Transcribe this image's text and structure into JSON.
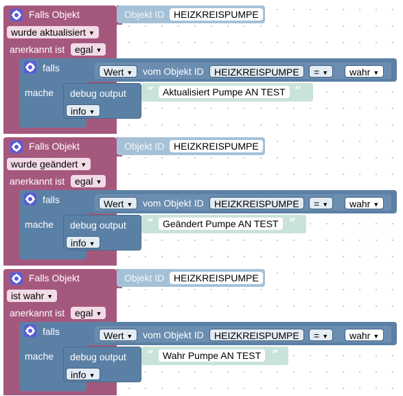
{
  "blocks": [
    {
      "trigger_label": "Falls Objekt",
      "object_id_label": "Objekt ID",
      "object_id_value": "HEIZKREISPUMPE",
      "event_type": "wurde aktualisiert",
      "ack_label": "anerkannt ist",
      "ack_value": "egal",
      "if_label": "falls",
      "do_label": "mache",
      "compare_left_value": "Wert",
      "compare_from_label": "vom Objekt ID",
      "compare_object_id": "HEIZKREISPUMPE",
      "operator": "=",
      "compare_right_value": "wahr",
      "debug_label": "debug output",
      "debug_text": "Aktualisiert Pumpe AN TEST",
      "debug_level": "info"
    },
    {
      "trigger_label": "Falls Objekt",
      "object_id_label": "Objekt ID",
      "object_id_value": "HEIZKREISPUMPE",
      "event_type": "wurde geändert",
      "ack_label": "anerkannt ist",
      "ack_value": "egal",
      "if_label": "falls",
      "do_label": "mache",
      "compare_left_value": "Wert",
      "compare_from_label": "vom Objekt ID",
      "compare_object_id": "HEIZKREISPUMPE",
      "operator": "=",
      "compare_right_value": "wahr",
      "debug_label": "debug output",
      "debug_text": "Geändert Pumpe AN TEST",
      "debug_level": "info"
    },
    {
      "trigger_label": "Falls Objekt",
      "object_id_label": "Objekt ID",
      "object_id_value": "HEIZKREISPUMPE",
      "event_type": "ist wahr",
      "ack_label": "anerkannt ist",
      "ack_value": "egal",
      "if_label": "falls",
      "do_label": "mache",
      "compare_left_value": "Wert",
      "compare_from_label": "vom Objekt ID",
      "compare_object_id": "HEIZKREISPUMPE",
      "operator": "=",
      "compare_right_value": "wahr",
      "debug_label": "debug output",
      "debug_text": "Wahr Pumpe AN TEST",
      "debug_level": "info"
    }
  ],
  "icons": {
    "block_settings": "gear-icon",
    "dropdown": "caret-down-icon",
    "quote_open": "quote-open-icon",
    "quote_close": "quote-close-icon"
  },
  "colors": {
    "event_block": "#a5587d",
    "logic_block": "#5b80a5",
    "object_id_block": "#a5c1d7",
    "text_block": "#c9e3d8"
  }
}
